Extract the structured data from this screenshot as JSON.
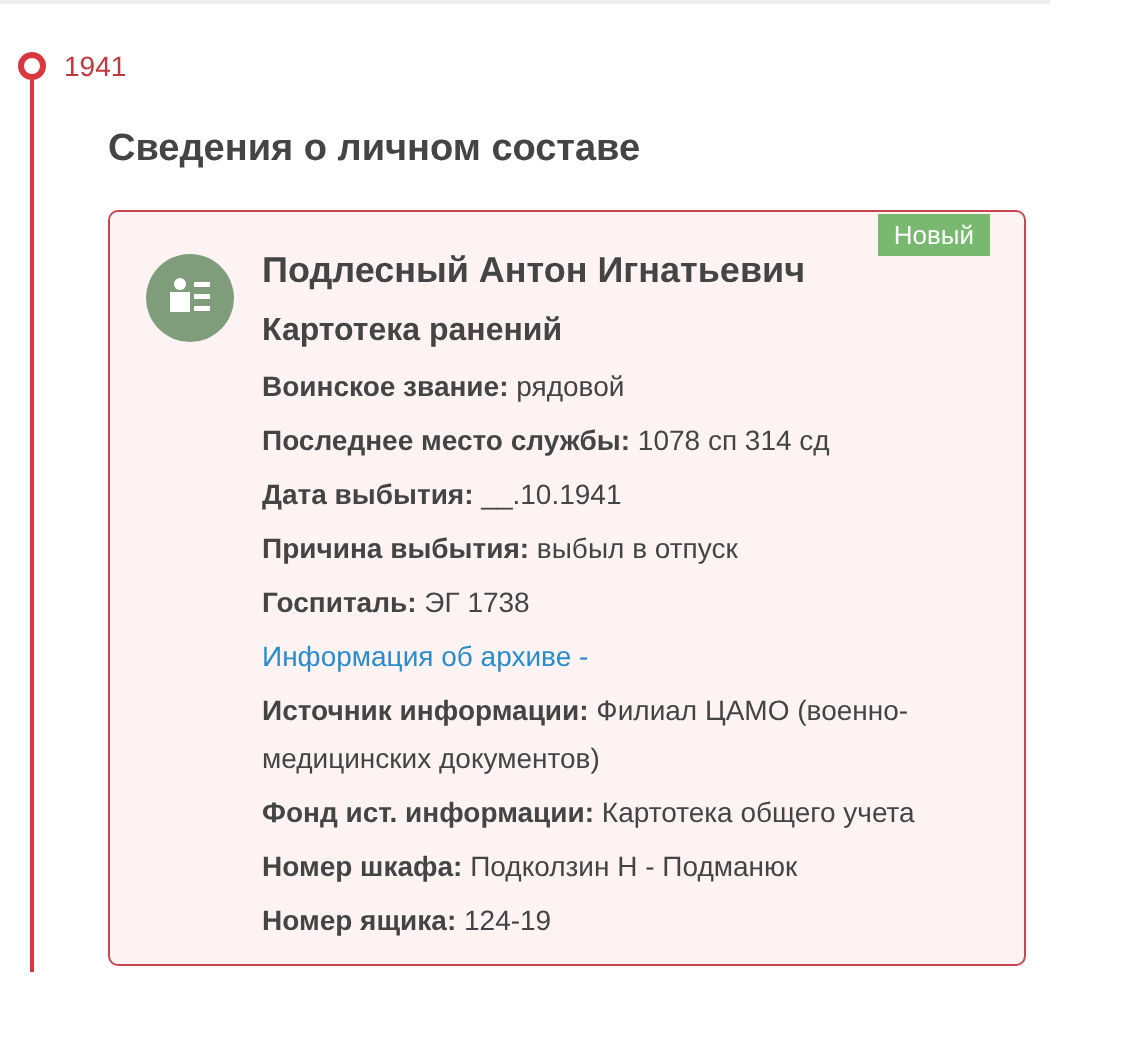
{
  "timeline": {
    "year": "1941"
  },
  "section": {
    "title": "Сведения о личном составе"
  },
  "card": {
    "badge": "Новый",
    "name": "Подлесный Антон Игнатьевич",
    "subtitle": "Картотека ранений",
    "rows": [
      {
        "kind": "field",
        "text": "**Воинское звание:** рядовой"
      },
      {
        "kind": "field",
        "text": "**Последнее место службы:** 1078 сп 314 сд"
      },
      {
        "kind": "field",
        "text": "**Дата выбытия:** __.10.1941"
      },
      {
        "kind": "field",
        "text": "**Причина выбытия:** выбыл в отпуск"
      },
      {
        "kind": "field",
        "text": "**Госпиталь:** ЭГ 1738"
      },
      {
        "kind": "link",
        "text": "Информация об архиве -"
      },
      {
        "kind": "field",
        "text": "**Источник информации:** Филиал ЦАМО (военно-медицинских документов)"
      },
      {
        "kind": "field",
        "text": "**Фонд ист. информации:** Картотека общего учета"
      },
      {
        "kind": "field",
        "text": "**Номер шкафа:** Подколзин Н - Подманюк"
      },
      {
        "kind": "field",
        "text": "**Номер ящика:** 124-19"
      }
    ]
  }
}
